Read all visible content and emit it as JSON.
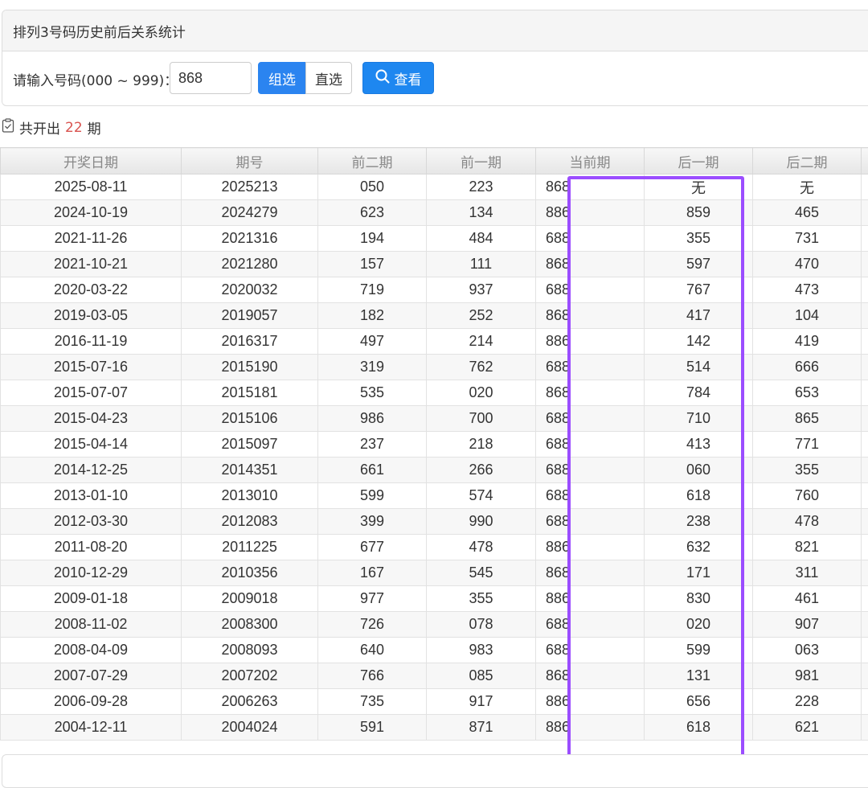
{
  "panel": {
    "title": "排列3号码历史前后关系统计",
    "query_label": "请输入号码(000 ~ 999)：",
    "input_value": "868",
    "group_label": "组选",
    "direct_label": "直选",
    "view_label": "查看"
  },
  "summary": {
    "prefix": "共开出",
    "count": "22",
    "suffix": "期"
  },
  "colors": {
    "primary": "#1e87f0",
    "highlight": "#9b4dff",
    "count": "#d9534f"
  },
  "table": {
    "headers": [
      "开奖日期",
      "期号",
      "前二期",
      "前一期",
      "当前期",
      "后一期",
      "后二期"
    ],
    "rows": [
      [
        "2025-08-11",
        "2025213",
        "050",
        "223",
        "868",
        "无",
        "无"
      ],
      [
        "2024-10-19",
        "2024279",
        "623",
        "134",
        "886",
        "859",
        "465"
      ],
      [
        "2021-11-26",
        "2021316",
        "194",
        "484",
        "688",
        "355",
        "731"
      ],
      [
        "2021-10-21",
        "2021280",
        "157",
        "111",
        "868",
        "597",
        "470"
      ],
      [
        "2020-03-22",
        "2020032",
        "719",
        "937",
        "688",
        "767",
        "473"
      ],
      [
        "2019-03-05",
        "2019057",
        "182",
        "252",
        "868",
        "417",
        "104"
      ],
      [
        "2016-11-19",
        "2016317",
        "497",
        "214",
        "886",
        "142",
        "419"
      ],
      [
        "2015-07-16",
        "2015190",
        "319",
        "762",
        "688",
        "514",
        "666"
      ],
      [
        "2015-07-07",
        "2015181",
        "535",
        "020",
        "868",
        "784",
        "653"
      ],
      [
        "2015-04-23",
        "2015106",
        "986",
        "700",
        "688",
        "710",
        "865"
      ],
      [
        "2015-04-14",
        "2015097",
        "237",
        "218",
        "688",
        "413",
        "771"
      ],
      [
        "2014-12-25",
        "2014351",
        "661",
        "266",
        "688",
        "060",
        "355"
      ],
      [
        "2013-01-10",
        "2013010",
        "599",
        "574",
        "688",
        "618",
        "760"
      ],
      [
        "2012-03-30",
        "2012083",
        "399",
        "990",
        "688",
        "238",
        "478"
      ],
      [
        "2011-08-20",
        "2011225",
        "677",
        "478",
        "886",
        "632",
        "821"
      ],
      [
        "2010-12-29",
        "2010356",
        "167",
        "545",
        "868",
        "171",
        "311"
      ],
      [
        "2009-01-18",
        "2009018",
        "977",
        "355",
        "886",
        "830",
        "461"
      ],
      [
        "2008-11-02",
        "2008300",
        "726",
        "078",
        "688",
        "020",
        "907"
      ],
      [
        "2008-04-09",
        "2008093",
        "640",
        "983",
        "688",
        "599",
        "063"
      ],
      [
        "2007-07-29",
        "2007202",
        "766",
        "085",
        "868",
        "131",
        "981"
      ],
      [
        "2006-09-28",
        "2006263",
        "735",
        "917",
        "886",
        "656",
        "228"
      ],
      [
        "2004-12-11",
        "2004024",
        "591",
        "871",
        "886",
        "618",
        "621"
      ]
    ]
  }
}
